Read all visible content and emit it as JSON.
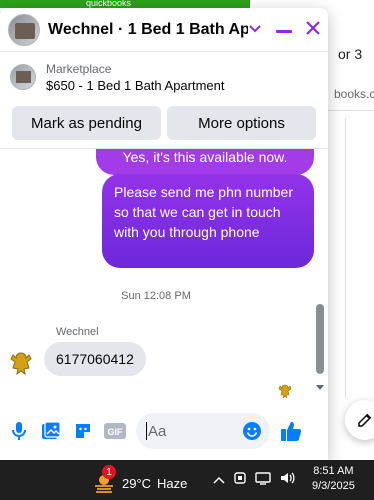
{
  "background": {
    "brand": "quickbooks",
    "text_right_top": "or 3",
    "text_right_url": "books.c"
  },
  "chat": {
    "contact_name": "Wechnel · 1 Bed 1 Bath Ap...",
    "listing": {
      "label": "Marketplace",
      "title": "$650 - 1 Bed 1 Bath Apartment"
    },
    "actions": {
      "mark_pending": "Mark as pending",
      "more_options": "More options"
    },
    "messages": {
      "outgoing_1": "Yes, it's this available now.",
      "outgoing_2": "Please send me  phn number so that we can get in touch with you through phone",
      "timestamp": "Sun 12:08 PM",
      "sender_name": "Wechnel",
      "incoming_1": "6177060412"
    },
    "composer": {
      "placeholder": "Aa"
    }
  },
  "taskbar": {
    "notification_count": "1",
    "temperature": "29°C",
    "weather_condition": "Haze",
    "time": "8:51 AM",
    "date": "9/3/2025"
  },
  "colors": {
    "accent_purple": "#8a2be2",
    "outgoing_bubble": "#7c3aed",
    "messenger_blue": "#0a7cff"
  }
}
